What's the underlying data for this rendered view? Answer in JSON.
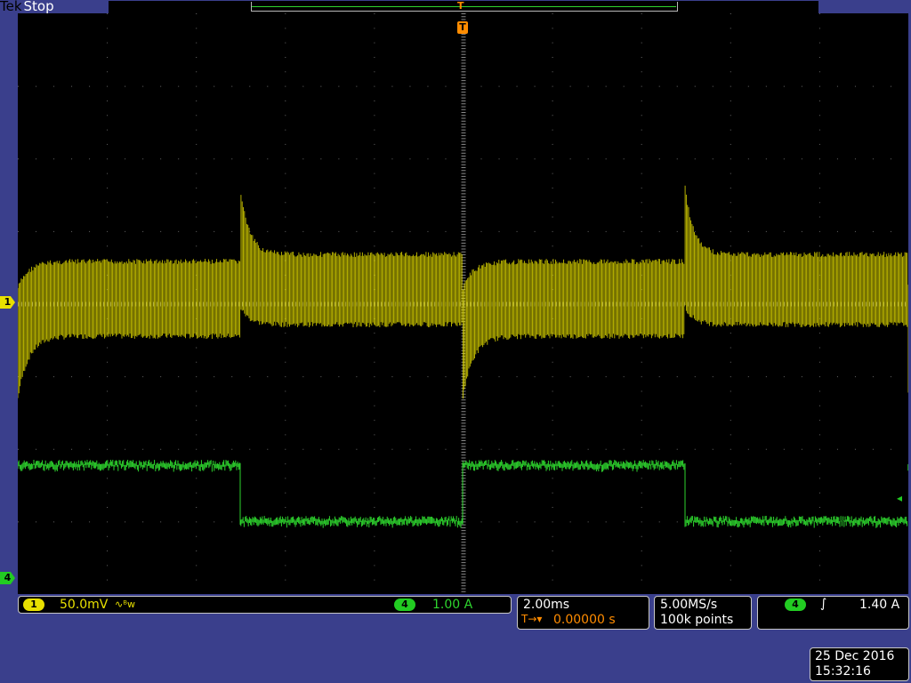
{
  "header": {
    "brand": "Tek",
    "status": "Stop"
  },
  "markers": {
    "trigger_position": "T",
    "trigger_small": "T",
    "ch1": "1",
    "ch4": "4",
    "trigger_level_arrow": "◂"
  },
  "channels": {
    "ch1": {
      "number": "1",
      "scale": "50.0mV",
      "coupling_icon": "∿ᴮw",
      "color": "#e8e000"
    },
    "ch4": {
      "number": "4",
      "scale": "1.00 A",
      "color": "#2ed52e"
    }
  },
  "timebase": {
    "scale": "2.00ms",
    "delay_icon": "T→▾",
    "delay": "0.00000 s"
  },
  "acquisition": {
    "sample_rate": "5.00MS/s",
    "record_length": "100k points"
  },
  "trigger": {
    "source": "4",
    "slope_icon": "∫",
    "level": "1.40 A"
  },
  "clock": {
    "date": "25 Dec 2016",
    "time": "15:32:16"
  },
  "colors": {
    "background": "#3a3f8c",
    "screen": "#000000",
    "ch1": "#e8e000",
    "ch4": "#2ed52e",
    "trigger": "#ff8c00"
  }
}
